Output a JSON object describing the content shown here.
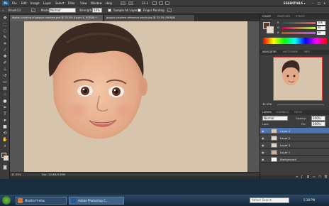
{
  "app": {
    "logo": "Ps",
    "menus": [
      "File",
      "Edit",
      "Image",
      "Layer",
      "Select",
      "Filter",
      "View",
      "Window",
      "Help"
    ],
    "zoom_menu": "33.3",
    "workspace": "ESSENTIALS ▾"
  },
  "options_bar": {
    "brush_label": "Brush:",
    "brush_size": "13",
    "mode_label": "Mode:",
    "mode_value": "Normal",
    "strength_label": "Strength:",
    "strength_value": "50%",
    "sample_all_layers": "Sample All Layers",
    "finger_painting": "Finger Painting"
  },
  "doc_tabs": [
    {
      "label": "digital painting of gagoys nephew.psd @ 33.3% (Layer 4, RGB/8) *",
      "active": true
    },
    {
      "label": "gagoys nephew reference photo.jpg @ 33.3% (RGB/8)",
      "active": false
    }
  ],
  "status": {
    "zoom": "33.33%",
    "doc": "Doc: 20.8M/9.39M"
  },
  "color_panel": {
    "tabs": [
      "COLOR",
      "SWATCHES",
      "STYLES"
    ],
    "channels": [
      {
        "label": "R",
        "value": "188"
      },
      {
        "label": "G",
        "value": "90"
      },
      {
        "label": "B",
        "value": "86"
      }
    ]
  },
  "navigator_panel": {
    "tabs": [
      "NAVIGATOR",
      "HISTOGRAM",
      "INFO"
    ],
    "zoom": "33.33%"
  },
  "layers_panel": {
    "tabs": [
      "LAYERS",
      "CHANNELS",
      "PATHS"
    ],
    "blend_mode": "Normal",
    "opacity_label": "Opacity:",
    "opacity_value": "100%",
    "lock_label": "Lock:",
    "fill_label": "Fill:",
    "fill_value": "100%",
    "layers": [
      {
        "name": "Layer 4",
        "selected": true
      },
      {
        "name": "Layer 2",
        "selected": false
      },
      {
        "name": "Layer 3",
        "selected": false
      },
      {
        "name": "Layer 1",
        "selected": false
      },
      {
        "name": "Background",
        "selected": false
      }
    ]
  },
  "taskbar": {
    "items": [
      {
        "label": "Mozilla Firefox",
        "color": "#e8711c"
      },
      {
        "label": "Adobe Photoshop C...",
        "color": "#1f5c99"
      }
    ],
    "search_placeholder": "Yahoo! Search",
    "clock": "5:38 PM"
  },
  "colors": {
    "canvas_bg": "#d6c4ad",
    "accent": "#4d74b0"
  }
}
